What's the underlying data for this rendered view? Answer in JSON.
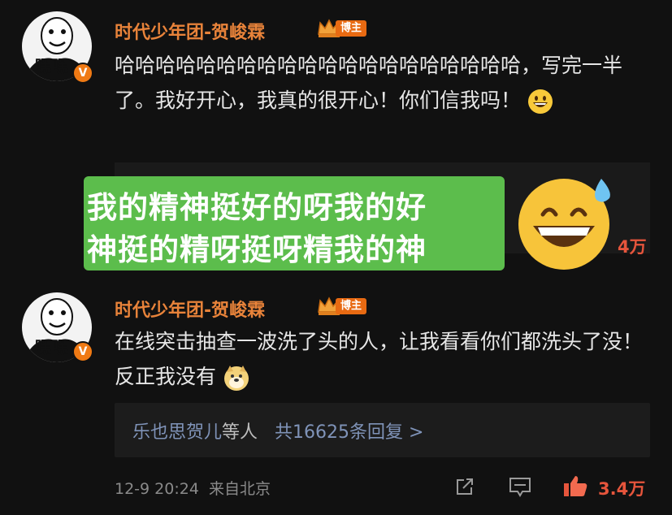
{
  "comments": [
    {
      "username": "时代少年团-贺峻霖",
      "badge": "博主",
      "avatar_text": "嘿嘿",
      "verified_label": "V",
      "text": "哈哈哈哈哈哈哈哈哈哈哈哈哈哈哈哈哈哈哈哈，写完一半了。我好开心，我真的很开心！你们信我吗！",
      "emoji": "grinning-face"
    },
    {
      "username": "时代少年团-贺峻霖",
      "badge": "博主",
      "avatar_text": "嘿嘿",
      "verified_label": "V",
      "text": "在线突击抽查一波洗了头的人，让我看看你们都洗头了没！反正我没有",
      "emoji": "doge"
    }
  ],
  "first_comment_likes": "4万",
  "overlay": {
    "line1": "我的精神挺好的呀我的好",
    "line2": "神挺的精呀挺呀精我的神",
    "emoji": "grinning-sweat-face",
    "bg_color": "#5cbd4c"
  },
  "replies": {
    "names": "乐也思贺儿",
    "suffix": "等人",
    "count": "共16625条回复 >"
  },
  "footer": {
    "timestamp": "12-9 20:24",
    "location": "来自北京",
    "likes": "3.4万"
  },
  "colors": {
    "username": "#e8833a",
    "link": "#7f93b8",
    "like": "#e6553c",
    "background": "#111111"
  },
  "icons": [
    "share-icon",
    "comment-icon",
    "thumbs-up-icon"
  ]
}
